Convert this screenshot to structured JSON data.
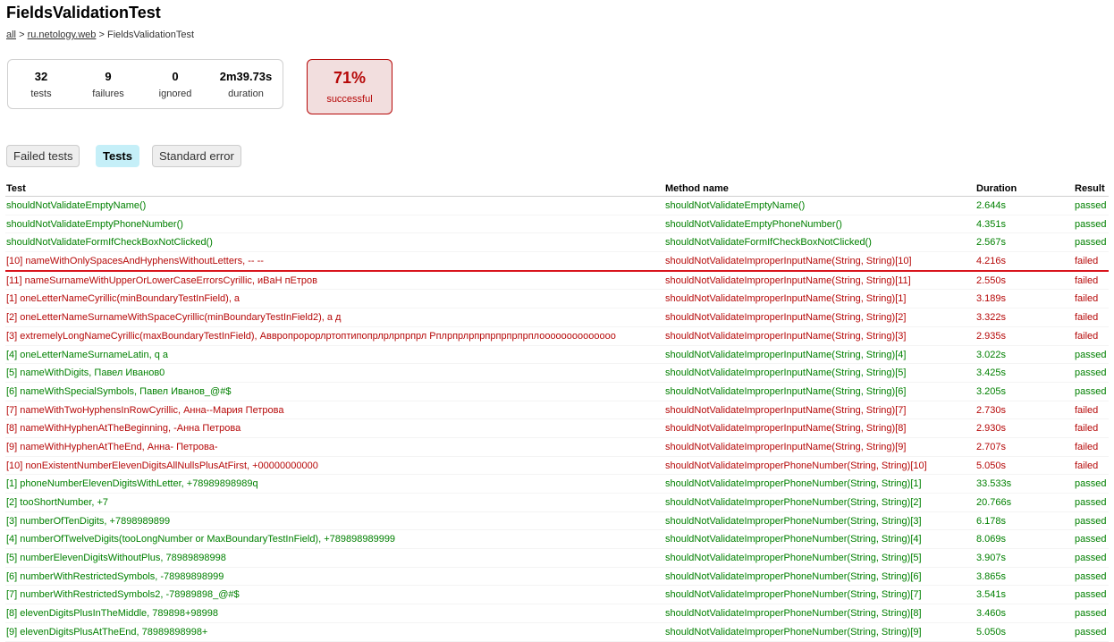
{
  "title": "FieldsValidationTest",
  "breadcrumbs": {
    "all": "all",
    "sep": ">",
    "package": "ru.netology.web",
    "current": "FieldsValidationTest"
  },
  "summary": {
    "tests": {
      "value": "32",
      "label": "tests"
    },
    "failures": {
      "value": "9",
      "label": "failures"
    },
    "ignored": {
      "value": "0",
      "label": "ignored"
    },
    "duration": {
      "value": "2m39.73s",
      "label": "duration"
    },
    "success": {
      "value": "71%",
      "label": "successful"
    }
  },
  "tabs": [
    {
      "label": "Failed tests",
      "active": false
    },
    {
      "label": "Tests",
      "active": true
    },
    {
      "label": "Standard error",
      "active": false
    }
  ],
  "table": {
    "headers": [
      "Test",
      "Method name",
      "Duration",
      "Result"
    ],
    "rows": [
      {
        "test": "shouldNotValidateEmptyName()",
        "method": "shouldNotValidateEmptyName()",
        "duration": "2.644s",
        "result": "passed"
      },
      {
        "test": "shouldNotValidateEmptyPhoneNumber()",
        "method": "shouldNotValidateEmptyPhoneNumber()",
        "duration": "4.351s",
        "result": "passed"
      },
      {
        "test": "shouldNotValidateFormIfCheckBoxNotClicked()",
        "method": "shouldNotValidateFormIfCheckBoxNotClicked()",
        "duration": "2.567s",
        "result": "passed"
      },
      {
        "test": "[10] nameWithOnlySpacesAndHyphensWithoutLetters, -- --",
        "method": "shouldNotValidateImproperInputName(String, String)[10]",
        "duration": "4.216s",
        "result": "failed"
      },
      {
        "test": "[11] nameSurnameWithUpperOrLowerCaseErrorsCyrillic, иВаН пЕтров",
        "method": "shouldNotValidateImproperInputName(String, String)[11]",
        "duration": "2.550s",
        "result": "failed"
      },
      {
        "test": "[1] oneLetterNameCyrillic(minBoundaryTestInField), а",
        "method": "shouldNotValidateImproperInputName(String, String)[1]",
        "duration": "3.189s",
        "result": "failed"
      },
      {
        "test": "[2] oneLetterNameSurnameWithSpaceCyrillic(minBoundaryTestInField2), а д",
        "method": "shouldNotValidateImproperInputName(String, String)[2]",
        "duration": "3.322s",
        "result": "failed"
      },
      {
        "test": "[3] extremelyLongNameCyrillic(maxBoundaryTestInField), Аввропророрлртоптипопрлрлрпрпрл Рплрпрлрпрпрпрпрпрплоооооооооооооо",
        "method": "shouldNotValidateImproperInputName(String, String)[3]",
        "duration": "2.935s",
        "result": "failed"
      },
      {
        "test": "[4] oneLetterNameSurnameLatin, q a",
        "method": "shouldNotValidateImproperInputName(String, String)[4]",
        "duration": "3.022s",
        "result": "passed"
      },
      {
        "test": "[5] nameWithDigits, Павел Иванов0",
        "method": "shouldNotValidateImproperInputName(String, String)[5]",
        "duration": "3.425s",
        "result": "passed"
      },
      {
        "test": "[6] nameWithSpecialSymbols, Павел Иванов_@#$",
        "method": "shouldNotValidateImproperInputName(String, String)[6]",
        "duration": "3.205s",
        "result": "passed"
      },
      {
        "test": "[7] nameWithTwoHyphensInRowCyrillic, Анна--Мария Петрова",
        "method": "shouldNotValidateImproperInputName(String, String)[7]",
        "duration": "2.730s",
        "result": "failed"
      },
      {
        "test": "[8] nameWithHyphenAtTheBeginning, -Анна Петрова",
        "method": "shouldNotValidateImproperInputName(String, String)[8]",
        "duration": "2.930s",
        "result": "failed"
      },
      {
        "test": "[9] nameWithHyphenAtTheEnd, Анна- Петрова-",
        "method": "shouldNotValidateImproperInputName(String, String)[9]",
        "duration": "2.707s",
        "result": "failed"
      },
      {
        "test": "[10] nonExistentNumberElevenDigitsAllNullsPlusAtFirst, +00000000000",
        "method": "shouldNotValidateImproperPhoneNumber(String, String)[10]",
        "duration": "5.050s",
        "result": "failed"
      },
      {
        "test": "[1] phoneNumberElevenDigitsWithLetter, +78989898989q",
        "method": "shouldNotValidateImproperPhoneNumber(String, String)[1]",
        "duration": "33.533s",
        "result": "passed"
      },
      {
        "test": "[2] tooShortNumber, +7",
        "method": "shouldNotValidateImproperPhoneNumber(String, String)[2]",
        "duration": "20.766s",
        "result": "passed"
      },
      {
        "test": "[3] numberOfTenDigits, +7898989899",
        "method": "shouldNotValidateImproperPhoneNumber(String, String)[3]",
        "duration": "6.178s",
        "result": "passed"
      },
      {
        "test": "[4] numberOfTwelveDigits(tooLongNumber or MaxBoundaryTestInField), +789898989999",
        "method": "shouldNotValidateImproperPhoneNumber(String, String)[4]",
        "duration": "8.069s",
        "result": "passed"
      },
      {
        "test": "[5] numberElevenDigitsWithoutPlus, 78989898998",
        "method": "shouldNotValidateImproperPhoneNumber(String, String)[5]",
        "duration": "3.907s",
        "result": "passed"
      },
      {
        "test": "[6] numberWithRestrictedSymbols, -78989898999",
        "method": "shouldNotValidateImproperPhoneNumber(String, String)[6]",
        "duration": "3.865s",
        "result": "passed"
      },
      {
        "test": "[7] numberWithRestrictedSymbols2, -78989898_@#$",
        "method": "shouldNotValidateImproperPhoneNumber(String, String)[7]",
        "duration": "3.541s",
        "result": "passed"
      },
      {
        "test": "[8] elevenDigitsPlusInTheMiddle, 789898+98998",
        "method": "shouldNotValidateImproperPhoneNumber(String, String)[8]",
        "duration": "3.460s",
        "result": "passed"
      },
      {
        "test": "[9] elevenDigitsPlusAtTheEnd, 78989898998+",
        "method": "shouldNotValidateImproperPhoneNumber(String, String)[9]",
        "duration": "5.050s",
        "result": "passed"
      }
    ]
  },
  "colors": {
    "passed": "#008000",
    "failed": "#b60808",
    "successBg": "#f2dede",
    "activeTab": "#c5eff8",
    "divider": "#d9141c"
  }
}
